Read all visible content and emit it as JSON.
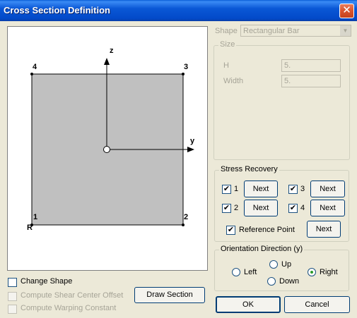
{
  "window": {
    "title": "Cross Section Definition",
    "close_label": "✕"
  },
  "diagram": {
    "axis_z": "z",
    "axis_y": "y",
    "corners": [
      "1",
      "2",
      "3",
      "4"
    ],
    "ref_label": "R"
  },
  "left_controls": {
    "change_shape": "Change Shape",
    "compute_shear": "Compute Shear Center Offset",
    "compute_warping": "Compute Warping Constant",
    "draw_section": "Draw Section"
  },
  "shape": {
    "label": "Shape",
    "value": "Rectangular Bar"
  },
  "size": {
    "title": "Size",
    "h_label": "H",
    "h_value": "5.",
    "width_label": "Width",
    "width_value": "5."
  },
  "stress_recovery": {
    "title": "Stress Recovery",
    "points": [
      {
        "num": "1",
        "checked": true,
        "next": "Next"
      },
      {
        "num": "2",
        "checked": true,
        "next": "Next"
      },
      {
        "num": "3",
        "checked": true,
        "next": "Next"
      },
      {
        "num": "4",
        "checked": true,
        "next": "Next"
      }
    ],
    "ref_point": "Reference Point",
    "ref_next": "Next"
  },
  "orientation": {
    "title": "Orientation Direction (y)",
    "left": "Left",
    "up": "Up",
    "down": "Down",
    "right": "Right",
    "selected": "Right"
  },
  "footer": {
    "ok": "OK",
    "cancel": "Cancel"
  }
}
